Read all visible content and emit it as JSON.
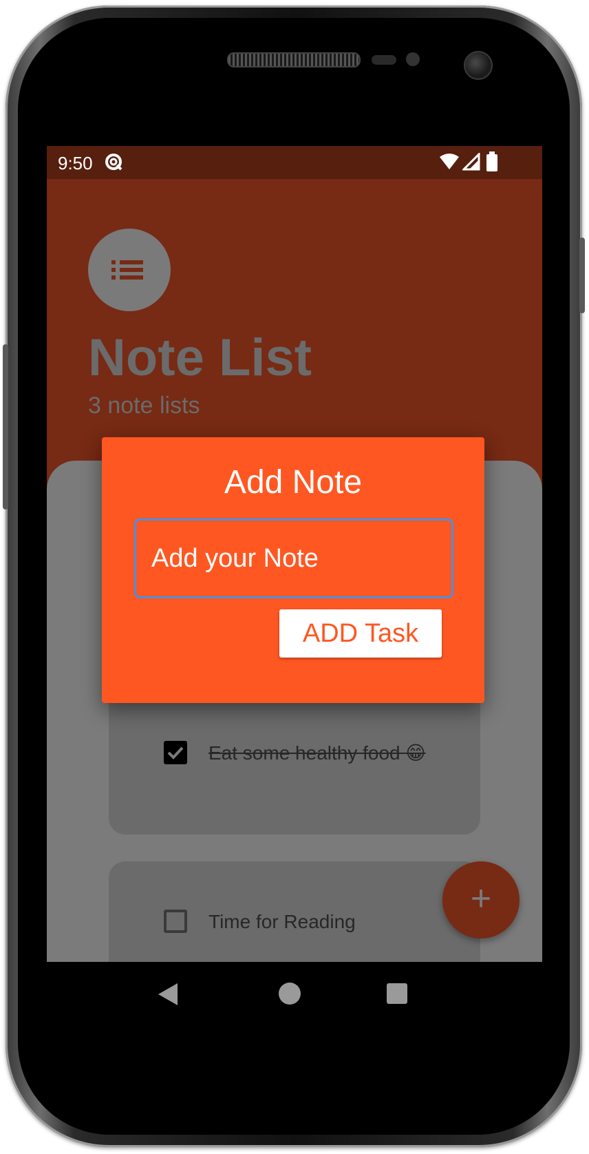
{
  "status_bar": {
    "time": "9:50",
    "icons": [
      "sync-icon",
      "wifi-icon",
      "signal-icon",
      "battery-icon"
    ]
  },
  "header": {
    "icon": "list-icon",
    "title": "Note List",
    "subtitle": "3 note lists"
  },
  "dialog": {
    "title": "Add Note",
    "input_placeholder": "Add your Note",
    "input_value": "",
    "add_button_label": "ADD Task"
  },
  "tasks": [
    {
      "text": "Eat some healthy food 😁",
      "completed": true
    },
    {
      "text": "Time for Reading",
      "completed": false
    }
  ],
  "fab": {
    "icon": "plus-icon",
    "label": "+"
  },
  "navigation": {
    "icons": [
      "back-icon",
      "home-icon",
      "recents-icon"
    ]
  },
  "colors": {
    "primary": "#ff5722",
    "header_background": "#772a14",
    "status_bar": "#561f0e",
    "input_border": "#4a90e2"
  }
}
